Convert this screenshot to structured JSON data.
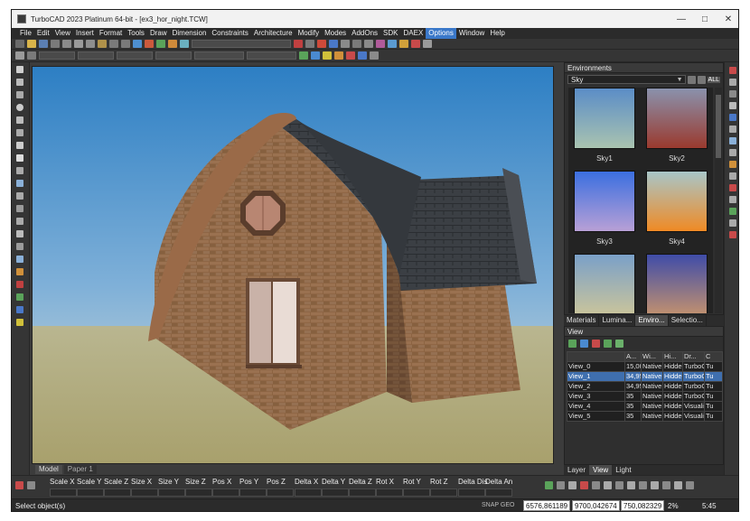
{
  "window": {
    "title": "TurboCAD 2023 Platinum 64-bit - [ex3_hor_night.TCW]"
  },
  "menu": [
    "File",
    "Edit",
    "View",
    "Insert",
    "Format",
    "Tools",
    "Draw",
    "Dimension",
    "Constraints",
    "Architecture",
    "Modify",
    "Modes",
    "AddOns",
    "SDK",
    "DAEX",
    "Options",
    "Window",
    "Help"
  ],
  "menu_active": "Options",
  "viewport_tabs": [
    "Model",
    "Paper 1"
  ],
  "environments": {
    "title": "Environments",
    "filter": "Sky",
    "all_label": "ALL",
    "items": [
      {
        "label": "Sky1",
        "top": "#5b8dc7",
        "bottom": "#a9c3b0"
      },
      {
        "label": "Sky2",
        "top": "#8a92ad",
        "bottom": "#9a3a2e"
      },
      {
        "label": "Sky3",
        "top": "#3b6fe0",
        "bottom": "#b8a0d6"
      },
      {
        "label": "Sky4",
        "top": "#a8c6c8",
        "bottom": "#f08a24"
      },
      {
        "label": "",
        "top": "#7aa0c8",
        "bottom": "#c9c49c"
      },
      {
        "label": "",
        "top": "#3f4ca8",
        "bottom": "#c09070"
      }
    ]
  },
  "panel_tabs": [
    "Materials",
    "Lumina...",
    "Enviro...",
    "Selectio..."
  ],
  "panel_tabs_active": "Enviro...",
  "view_panel": {
    "title": "View",
    "columns": [
      "A...",
      "Wi...",
      "Hi...",
      "Dr...",
      "C"
    ],
    "rows": [
      {
        "name": "View_0",
        "a": "15,00",
        "w": "Native",
        "h": "Hidden",
        "d": "TurboC",
        "c": "Tu",
        "selected": false
      },
      {
        "name": "View_1",
        "a": "34,95",
        "w": "Native",
        "h": "Hidden",
        "d": "TurboC",
        "c": "Tu",
        "selected": true
      },
      {
        "name": "View_2",
        "a": "34,95",
        "w": "Native",
        "h": "Hidden",
        "d": "TurboC",
        "c": "Tu",
        "selected": false
      },
      {
        "name": "View_3",
        "a": "35",
        "w": "Native",
        "h": "Hidden",
        "d": "TurboC",
        "c": "Tu",
        "selected": false
      },
      {
        "name": "View_4",
        "a": "35",
        "w": "Native",
        "h": "Hidden",
        "d": "Visuali",
        "c": "Tu",
        "selected": false
      },
      {
        "name": "View_5",
        "a": "35",
        "w": "Native",
        "h": "Hidden",
        "d": "Visuali",
        "c": "Tu",
        "selected": false
      }
    ]
  },
  "bottom_tabs": [
    "Layer",
    "View",
    "Light"
  ],
  "bottom_tabs_active": "View",
  "inspector": {
    "labels": [
      "Scale X",
      "Scale Y",
      "Scale Z",
      "Size X",
      "Size Y",
      "Size Z",
      "Pos X",
      "Pos Y",
      "Pos Z",
      "Delta X",
      "Delta Y",
      "Delta Z",
      "Rot X",
      "Rot Y",
      "Rot Z",
      "Delta Dis",
      "Delta An"
    ]
  },
  "status": {
    "message": "Select object(s)",
    "snap": "SNAP GEO",
    "x": "6576,861189",
    "y": "9700,042674",
    "z": "750,082329",
    "zoom": "2%",
    "time": "5:45"
  },
  "colors": {
    "accent": "#3a78c9",
    "sky_top": "#2d7fc4",
    "ground": "#b9b690",
    "roof": "#3b3f44",
    "brick": "#8c6442"
  }
}
